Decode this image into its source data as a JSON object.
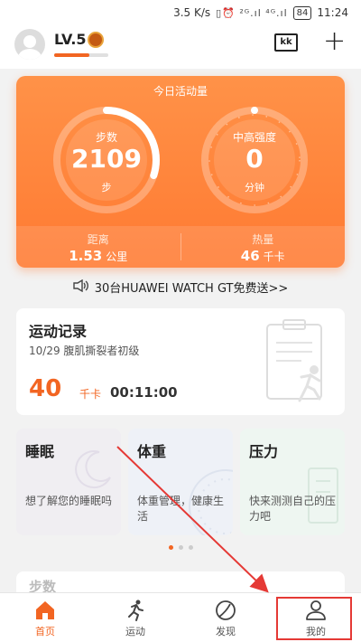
{
  "status_bar": {
    "speed": "3.5 K/s",
    "icons": "▯⏰ ²ᴳ.ıl ⁴ᴳ.ıl",
    "battery": "84",
    "time": "11:24"
  },
  "header": {
    "level": "LV.5",
    "level_progress": 0.65,
    "kk_label": "kk",
    "plus_label": "+"
  },
  "today_card": {
    "title": "今日活动量",
    "steps": {
      "label": "步数",
      "value": "2109",
      "unit": "步",
      "progress": 0.3
    },
    "intensity": {
      "label": "中高强度",
      "value": "0",
      "unit": "分钟",
      "progress": 0
    },
    "distance": {
      "label": "距离",
      "value": "1.53",
      "unit": "公里"
    },
    "calories": {
      "label": "热量",
      "value": "46",
      "unit": "千卡"
    }
  },
  "promo": {
    "text": "30台HUAWEI  WATCH GT免费送>>"
  },
  "record": {
    "title": "运动记录",
    "subtitle": "10/29  腹肌撕裂者初级",
    "calories_value": "40",
    "calories_unit": "千卡",
    "duration": "00:11:00"
  },
  "tiles": [
    {
      "title": "睡眠",
      "desc": "想了解您的睡眠吗",
      "bg": "#f0eef2"
    },
    {
      "title": "体重",
      "desc": "体重管理，健康生活",
      "bg": "#eef1f7"
    },
    {
      "title": "压力",
      "desc": "快来测测自己的压力吧",
      "bg": "#eef6f1"
    }
  ],
  "peek": {
    "text": "步数"
  },
  "tabbar": {
    "items": [
      {
        "label": "首页",
        "icon": "home-icon",
        "active": true
      },
      {
        "label": "运动",
        "icon": "running-icon",
        "active": false
      },
      {
        "label": "发现",
        "icon": "discover-icon",
        "active": false
      },
      {
        "label": "我的",
        "icon": "profile-icon",
        "active": false
      }
    ]
  },
  "colors": {
    "accent": "#f26522",
    "card_top": "#ff9248",
    "card_bottom": "#ff7a32",
    "annotation": "#e53935"
  }
}
